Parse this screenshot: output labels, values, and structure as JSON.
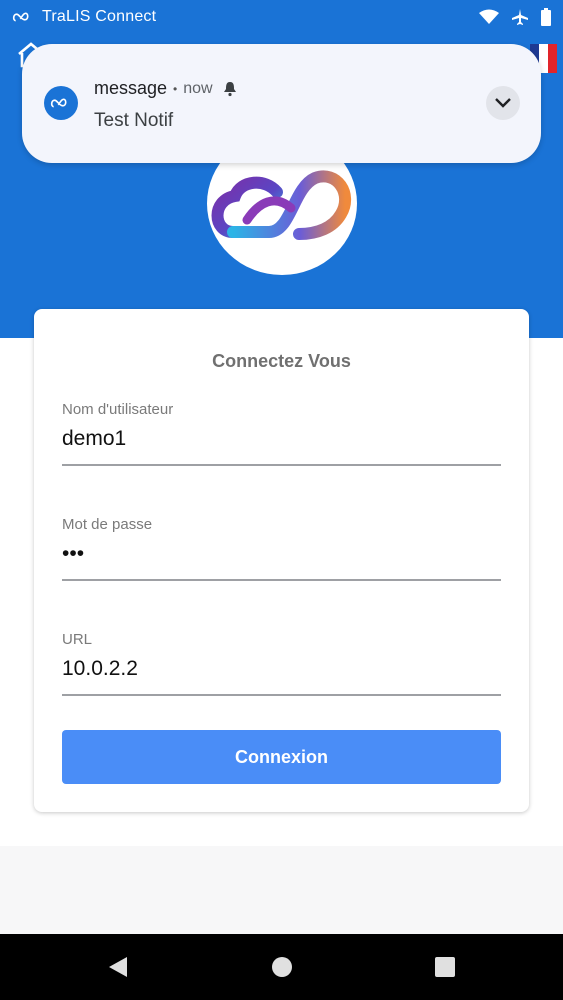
{
  "status_bar": {
    "app_name": "TraLIS Connect",
    "icons": [
      "tralis-logo-icon",
      "wifi-icon",
      "airplane-icon",
      "battery-icon"
    ]
  },
  "notification": {
    "app": "message",
    "separator": "•",
    "time": "now",
    "text": "Test Notif",
    "icons": [
      "tralis-logo-icon",
      "bell-icon",
      "chevron-down-icon"
    ]
  },
  "header": {
    "icons": [
      "home-icon",
      "flag-fr-icon"
    ],
    "flag_colors": [
      "#1f3a93",
      "#ffffff",
      "#e1242a"
    ]
  },
  "login": {
    "title": "Connectez Vous",
    "username": {
      "label": "Nom d'utilisateur",
      "value": "demo1"
    },
    "password": {
      "label": "Mot de passe",
      "value": "•••"
    },
    "url": {
      "label": "URL",
      "value": "10.0.2.2"
    },
    "submit_label": "Connexion"
  },
  "nav_bar": {
    "icons": [
      "back-icon",
      "home-circle-icon",
      "recents-icon"
    ]
  },
  "colors": {
    "primary_blue": "#1a73d6",
    "button_blue": "#4a8df7",
    "logo_purple": "#6b2fa0",
    "logo_cyan": "#2cb4e6",
    "logo_orange": "#f08a3c"
  }
}
